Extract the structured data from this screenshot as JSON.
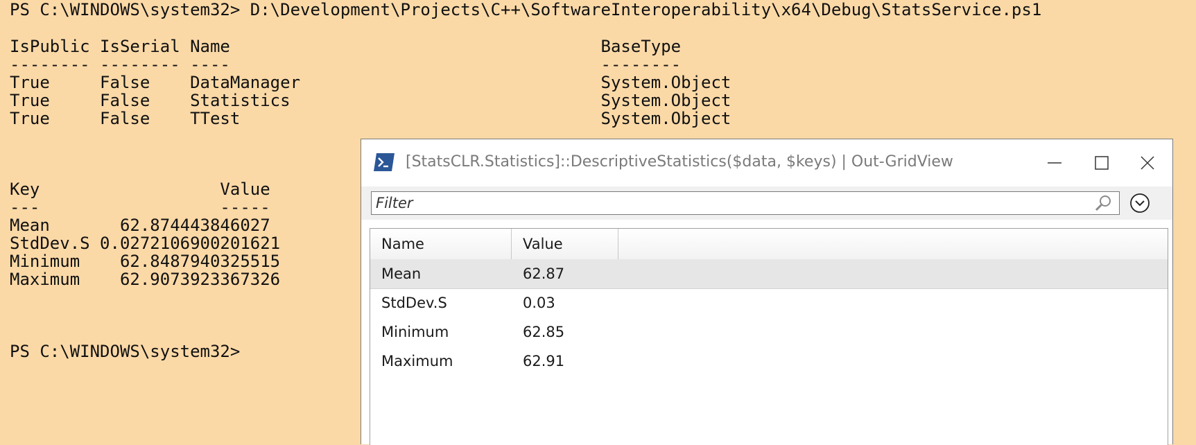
{
  "console": {
    "command_line": "PS C:\\WINDOWS\\system32> D:\\Development\\Projects\\C++\\SoftwareInteroperability\\x64\\Debug\\StatsService.ps1",
    "types_header": "IsPublic IsSerial Name                                     BaseType",
    "types_underline": "-------- -------- ----                                     --------",
    "types_rows": [
      "True     False    DataManager                              System.Object",
      "True     False    Statistics                               System.Object",
      "True     False    TTest                                    System.Object"
    ],
    "stats_header": "Key                  Value",
    "stats_underline": "---                  -----",
    "stats_rows": [
      "Mean       62.874443846027",
      "StdDev.S 0.0272106900201621",
      "Minimum    62.8487940325515",
      "Maximum    62.9073923367326"
    ],
    "prompt": "PS C:\\WINDOWS\\system32>"
  },
  "grid_window": {
    "title": "[StatsCLR.Statistics]::DescriptiveStatistics($data, $keys) | Out-GridView",
    "icon": "powershell-icon",
    "controls": {
      "minimize": "minimize-icon",
      "maximize": "maximize-icon",
      "close": "close-icon"
    },
    "filter": {
      "placeholder": "Filter",
      "value": "",
      "search_icon": "search-icon",
      "expand_icon": "chevron-down-icon"
    },
    "columns": [
      "Name",
      "Value"
    ],
    "rows": [
      {
        "name": "Mean",
        "value": "62.87",
        "selected": true
      },
      {
        "name": "StdDev.S",
        "value": "0.03",
        "selected": false
      },
      {
        "name": "Minimum",
        "value": "62.85",
        "selected": false
      },
      {
        "name": "Maximum",
        "value": "62.91",
        "selected": false
      }
    ]
  },
  "colors": {
    "console_background": "#fbd9a7",
    "console_text": "#111111",
    "window_title_text": "#7a7a7a",
    "selected_row": "#e6e6e6",
    "powershell_icon": "#2b5797"
  }
}
